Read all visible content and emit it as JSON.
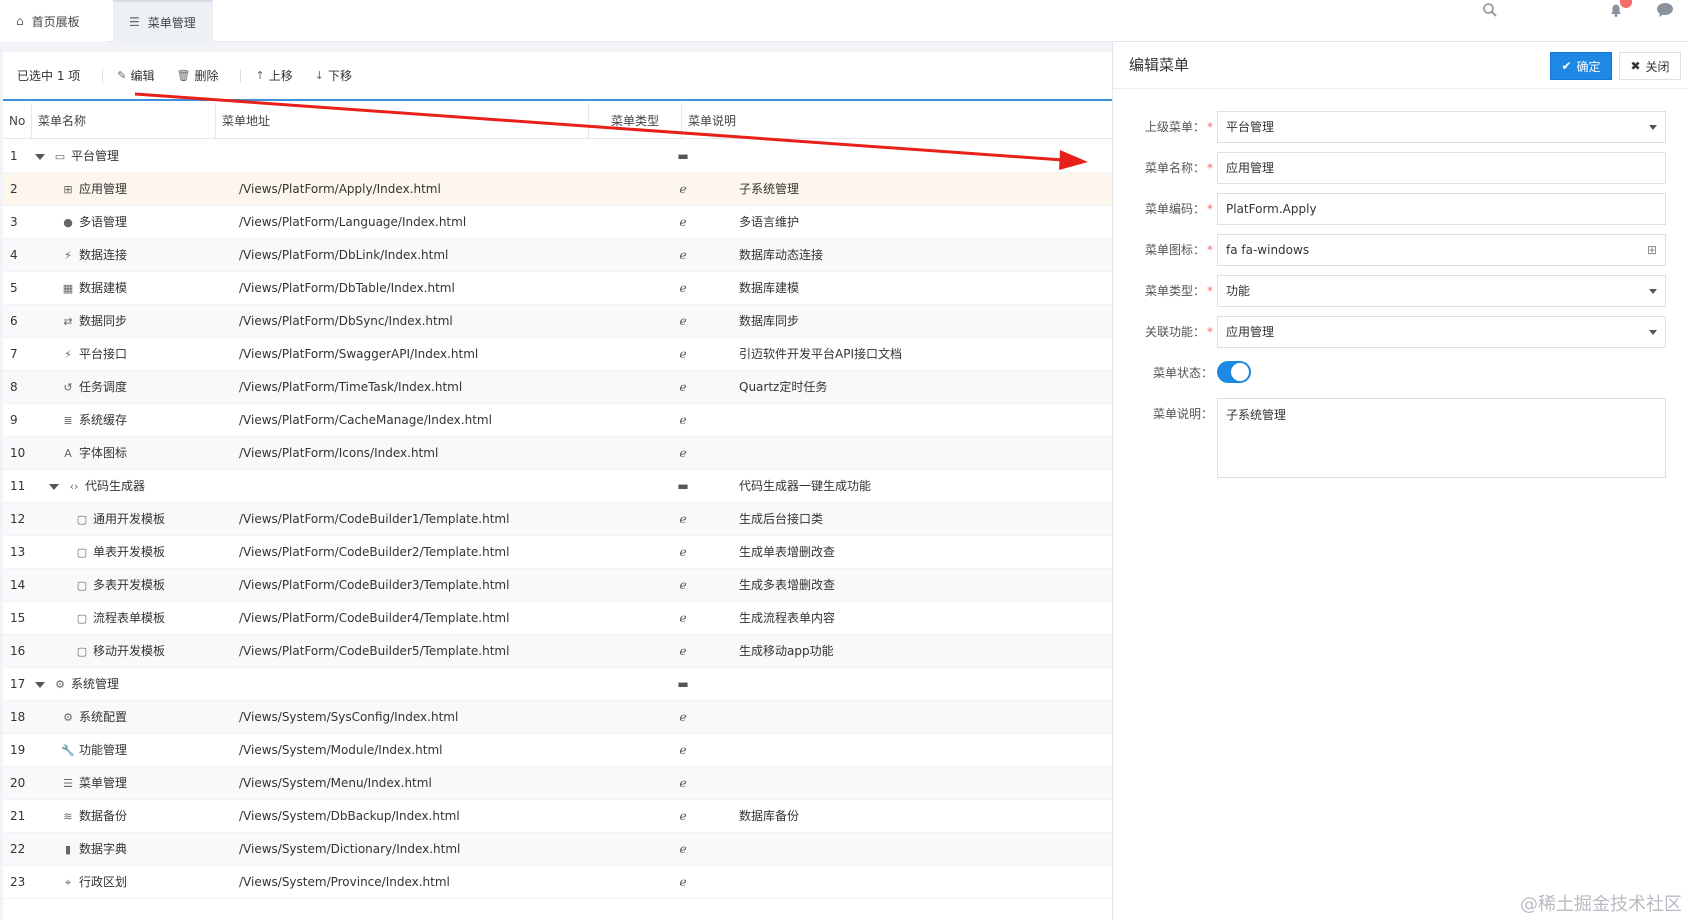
{
  "tabs": [
    {
      "label": "首页展板",
      "icon": "home-icon"
    },
    {
      "label": "菜单管理",
      "icon": "list-icon"
    }
  ],
  "toolbar": {
    "selected": "已选中 1 项",
    "edit": "编辑",
    "delete": "删除",
    "up": "上移",
    "down": "下移"
  },
  "table": {
    "headers": {
      "no": "No",
      "name": "菜单名称",
      "url": "菜单地址",
      "type": "菜单类型",
      "desc": "菜单说明"
    },
    "rows": [
      {
        "no": "1",
        "name": "平台管理",
        "url": "",
        "type": "folder",
        "desc": "",
        "level": 0,
        "expanded": true,
        "icon": "monitor-icon"
      },
      {
        "no": "2",
        "name": "应用管理",
        "url": "/Views/PlatForm/Apply/Index.html",
        "type": "page",
        "desc": "子系统管理",
        "level": 1,
        "icon": "windows-icon"
      },
      {
        "no": "3",
        "name": "多语管理",
        "url": "/Views/PlatForm/Language/Index.html",
        "type": "page",
        "desc": "多语言维护",
        "level": 1,
        "icon": "globe-icon"
      },
      {
        "no": "4",
        "name": "数据连接",
        "url": "/Views/PlatForm/DbLink/Index.html",
        "type": "page",
        "desc": "数据库动态连接",
        "level": 1,
        "icon": "plug-icon"
      },
      {
        "no": "5",
        "name": "数据建模",
        "url": "/Views/PlatForm/DbTable/Index.html",
        "type": "page",
        "desc": "数据库建模",
        "level": 1,
        "icon": "table-icon"
      },
      {
        "no": "6",
        "name": "数据同步",
        "url": "/Views/PlatForm/DbSync/Index.html",
        "type": "page",
        "desc": "数据库同步",
        "level": 1,
        "icon": "sync-icon"
      },
      {
        "no": "7",
        "name": "平台接口",
        "url": "/Views/PlatForm/SwaggerAPI/Index.html",
        "type": "page",
        "desc": "引迈软件开发平台API接口文档",
        "level": 1,
        "icon": "plug-icon"
      },
      {
        "no": "8",
        "name": "任务调度",
        "url": "/Views/PlatForm/TimeTask/Index.html",
        "type": "page",
        "desc": "Quartz定时任务",
        "level": 1,
        "icon": "history-icon"
      },
      {
        "no": "9",
        "name": "系统缓存",
        "url": "/Views/PlatForm/CacheManage/Index.html",
        "type": "page",
        "desc": "",
        "level": 1,
        "icon": "list-alt-icon"
      },
      {
        "no": "10",
        "name": "字体图标",
        "url": "/Views/PlatForm/Icons/Index.html",
        "type": "page",
        "desc": "",
        "level": 1,
        "icon": "font-icon"
      },
      {
        "no": "11",
        "name": "代码生成器",
        "url": "",
        "type": "folder",
        "desc": "代码生成器一键生成功能",
        "level": 1,
        "expanded": true,
        "icon": "code-icon"
      },
      {
        "no": "12",
        "name": "通用开发模板",
        "url": "/Views/PlatForm/CodeBuilder1/Template.html",
        "type": "page",
        "desc": "生成后台接口类",
        "level": 2,
        "icon": "file-icon"
      },
      {
        "no": "13",
        "name": "单表开发模板",
        "url": "/Views/PlatForm/CodeBuilder2/Template.html",
        "type": "page",
        "desc": "生成单表增删改查",
        "level": 2,
        "icon": "file-icon"
      },
      {
        "no": "14",
        "name": "多表开发模板",
        "url": "/Views/PlatForm/CodeBuilder3/Template.html",
        "type": "page",
        "desc": "生成多表增删改查",
        "level": 2,
        "icon": "file-icon"
      },
      {
        "no": "15",
        "name": "流程表单模板",
        "url": "/Views/PlatForm/CodeBuilder4/Template.html",
        "type": "page",
        "desc": "生成流程表单内容",
        "level": 2,
        "icon": "file-icon"
      },
      {
        "no": "16",
        "name": "移动开发模板",
        "url": "/Views/PlatForm/CodeBuilder5/Template.html",
        "type": "page",
        "desc": "生成移动app功能",
        "level": 2,
        "icon": "file-icon"
      },
      {
        "no": "17",
        "name": "系统管理",
        "url": "",
        "type": "folder",
        "desc": "",
        "level": 0,
        "expanded": true,
        "icon": "gear-icon"
      },
      {
        "no": "18",
        "name": "系统配置",
        "url": "/Views/System/SysConfig/Index.html",
        "type": "page",
        "desc": "",
        "level": 1,
        "icon": "gears-icon"
      },
      {
        "no": "19",
        "name": "功能管理",
        "url": "/Views/System/Module/Index.html",
        "type": "page",
        "desc": "",
        "level": 1,
        "icon": "wrench-icon"
      },
      {
        "no": "20",
        "name": "菜单管理",
        "url": "/Views/System/Menu/Index.html",
        "type": "page",
        "desc": "",
        "level": 1,
        "icon": "bars-icon"
      },
      {
        "no": "21",
        "name": "数据备份",
        "url": "/Views/System/DbBackup/Index.html",
        "type": "page",
        "desc": "数据库备份",
        "level": 1,
        "icon": "database-icon"
      },
      {
        "no": "22",
        "name": "数据字典",
        "url": "/Views/System/Dictionary/Index.html",
        "type": "page",
        "desc": "",
        "level": 1,
        "icon": "book-icon"
      },
      {
        "no": "23",
        "name": "行政区划",
        "url": "/Views/System/Province/Index.html",
        "type": "page",
        "desc": "",
        "level": 1,
        "icon": "map-marker-icon"
      }
    ]
  },
  "editor": {
    "title": "编辑菜单",
    "ok": "确定",
    "close": "关闭",
    "fields": {
      "parent_label": "上级菜单：",
      "parent_value": "平台管理",
      "name_label": "菜单名称：",
      "name_value": "应用管理",
      "code_label": "菜单编码：",
      "code_value": "PlatForm.Apply",
      "icon_label": "菜单图标：",
      "icon_value": "fa fa-windows",
      "type_label": "菜单类型：",
      "type_value": "功能",
      "func_label": "关联功能：",
      "func_value": "应用管理",
      "status_label": "菜单状态：",
      "status_on": true,
      "desc_label": "菜单说明：",
      "desc_value": "子系统管理"
    }
  },
  "watermark": "@稀土掘金技术社区",
  "colors": {
    "accent": "#1e88e5",
    "arrow": "#e8201a",
    "selected_row": "#fdf6ec"
  }
}
